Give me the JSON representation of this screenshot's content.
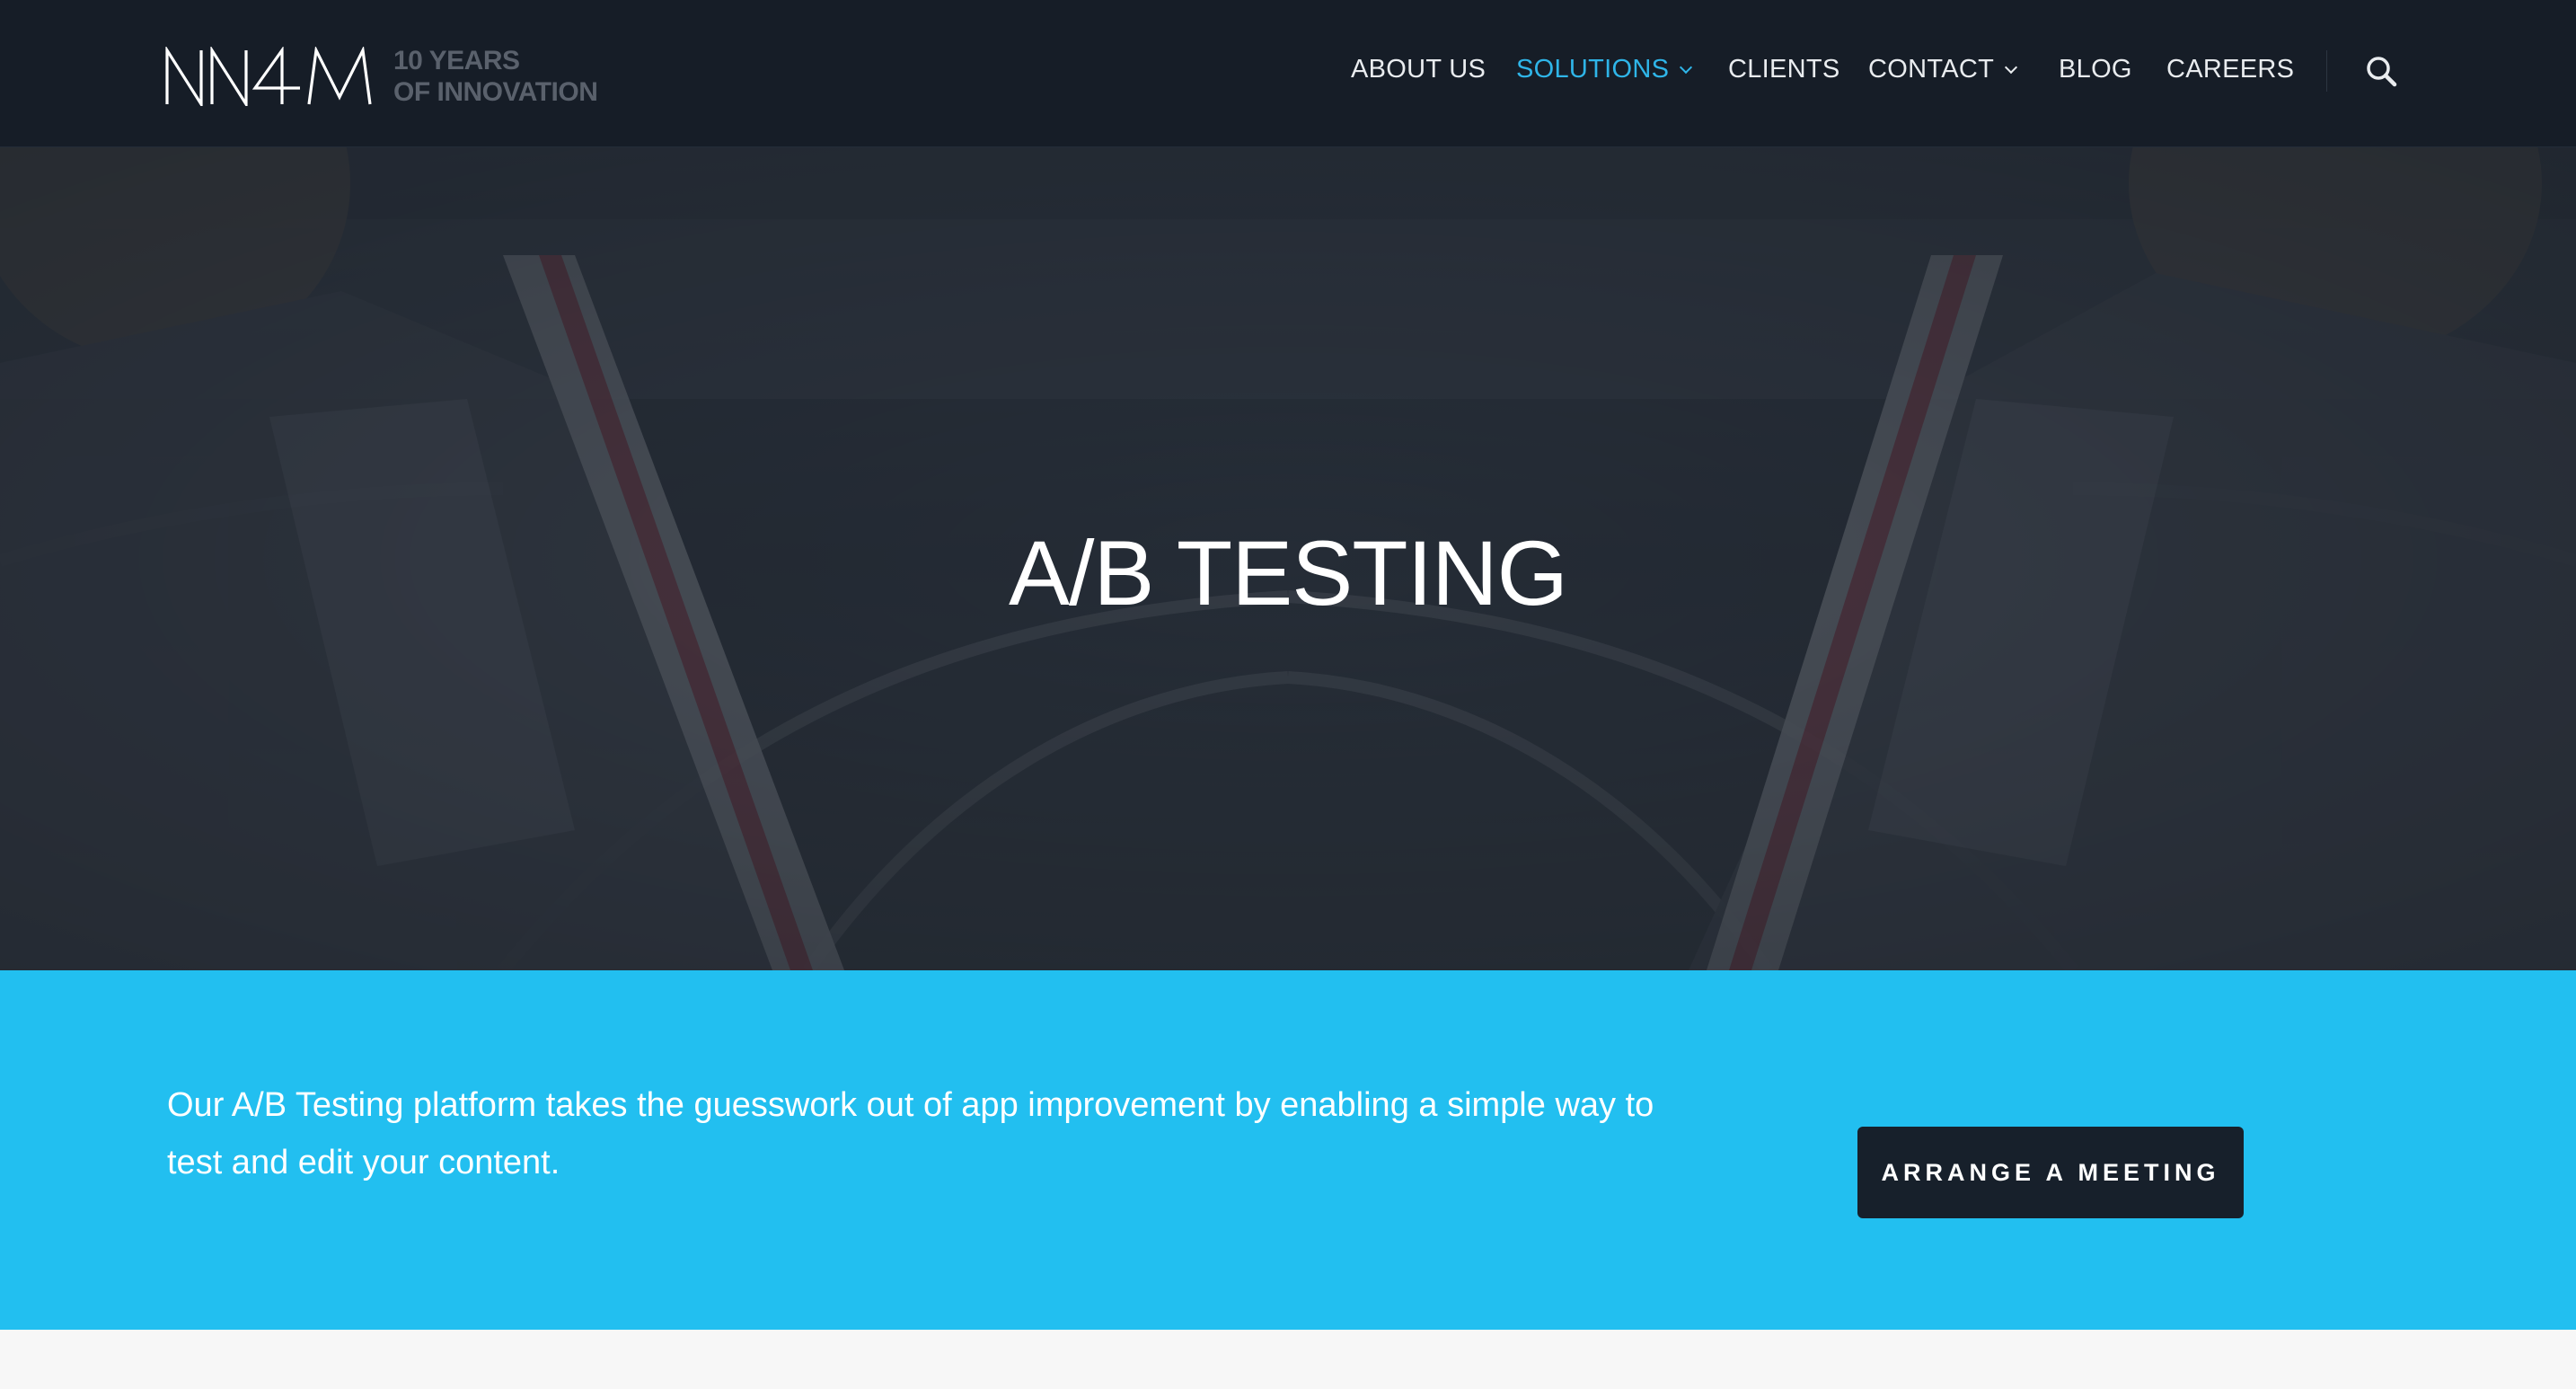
{
  "brand": {
    "logo_text": "NN4M",
    "tagline_line1": "10 YEARS",
    "tagline_line2": "OF INNOVATION"
  },
  "nav": {
    "items": [
      {
        "label": "ABOUT US",
        "active": false,
        "dropdown": false
      },
      {
        "label": "SOLUTIONS",
        "active": true,
        "dropdown": true
      },
      {
        "label": "CLIENTS",
        "active": false,
        "dropdown": false
      },
      {
        "label": "CONTACT",
        "active": false,
        "dropdown": true
      },
      {
        "label": "BLOG",
        "active": false,
        "dropdown": false
      },
      {
        "label": "CAREERS",
        "active": false,
        "dropdown": false
      }
    ],
    "search_icon": "search-icon"
  },
  "hero": {
    "title": "A/B TESTING"
  },
  "cta": {
    "text": "Our A/B Testing platform takes the guesswork out of app improvement by enabling a simple way to test and edit your content.",
    "button_label": "ARRANGE A MEETING"
  },
  "colors": {
    "header_bg": "#161d27",
    "accent": "#22bff0",
    "nav_active": "#2fb5e8",
    "button_bg": "#17202b"
  }
}
